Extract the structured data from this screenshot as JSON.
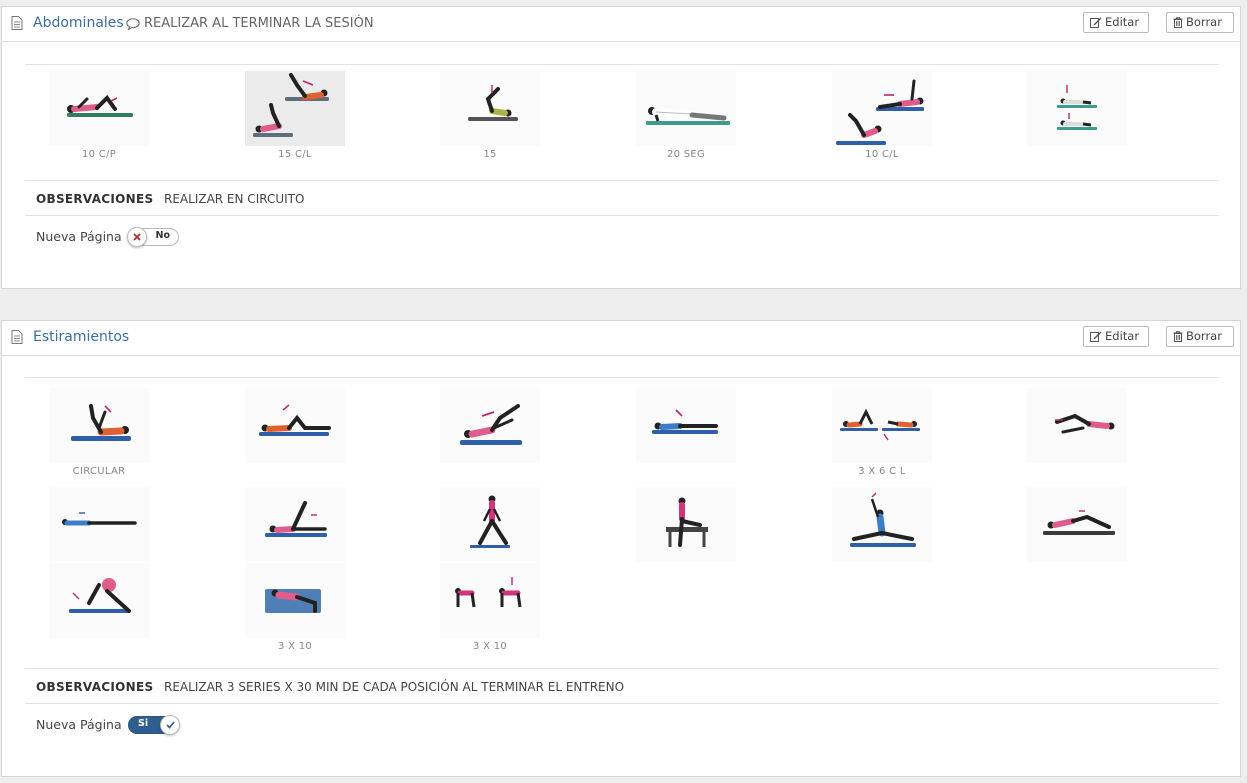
{
  "buttons": {
    "edit_label": "Editar",
    "delete_label": "Borrar"
  },
  "panels": [
    {
      "title": "Abdominales",
      "note": "REALIZAR AL TERMINAR LA SESIÓN",
      "exercises": [
        {
          "caption": "10 C/P"
        },
        {
          "caption": "15 C/L"
        },
        {
          "caption": "15"
        },
        {
          "caption": "20 SEG"
        },
        {
          "caption": "10 C/L"
        },
        {
          "caption": ""
        }
      ],
      "observations_label": "OBSERVACIONES",
      "observations_text": "REALIZAR EN CIRCUITO",
      "new_page_label": "Nueva Página",
      "new_page_toggle": {
        "state": "off",
        "text": "No"
      }
    },
    {
      "title": "Estiramientos",
      "note": "",
      "exercises": [
        {
          "caption": "CIRCULAR"
        },
        {
          "caption": ""
        },
        {
          "caption": ""
        },
        {
          "caption": ""
        },
        {
          "caption": "3 X 6 C L"
        },
        {
          "caption": ""
        },
        {
          "caption": ""
        },
        {
          "caption": ""
        },
        {
          "caption": ""
        },
        {
          "caption": ""
        },
        {
          "caption": ""
        },
        {
          "caption": ""
        },
        {
          "caption": ""
        },
        {
          "caption": "3 X 10"
        },
        {
          "caption": "3 X 10"
        }
      ],
      "observations_label": "OBSERVACIONES",
      "observations_text": "REALIZAR 3 SERIES X 30 MIN DE CADA POSICIÓN AL TERMINAR EL ENTRENO",
      "new_page_label": "Nueva Página",
      "new_page_toggle": {
        "state": "on",
        "text": "Si"
      }
    }
  ],
  "icons": {
    "title_icon": "document-icon",
    "note_icon": "comment-icon",
    "edit_icon": "edit-icon",
    "delete_icon": "trash-icon",
    "toggle_off_icon": "x-icon",
    "toggle_on_icon": "check-icon"
  },
  "colors": {
    "title": "#3a6ea5",
    "toggle_on": "#2f5d8f",
    "toggle_off_icon": "#b03030",
    "mat_colors": [
      "#2e7d5b",
      "#2f5fa8",
      "#3e9c8e",
      "#555555"
    ],
    "shirt_colors": [
      "#e05c8a",
      "#e06030",
      "#d2357a",
      "#3d7cc9"
    ]
  }
}
